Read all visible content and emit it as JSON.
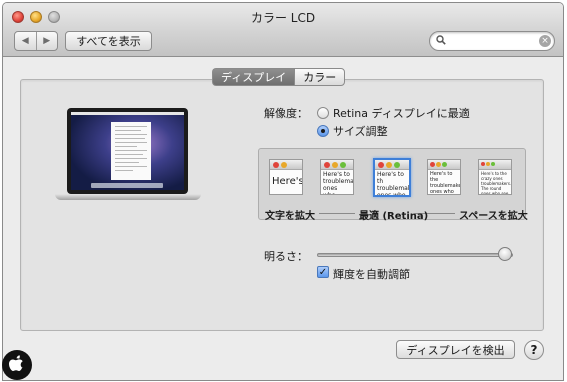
{
  "window": {
    "title": "カラー LCD"
  },
  "toolbar": {
    "back_icon": "back-arrow-icon",
    "forward_icon": "forward-arrow-icon",
    "show_all_label": "すべてを表示",
    "search_value": ""
  },
  "tabs": [
    {
      "label": "ディスプレイ",
      "selected": true
    },
    {
      "label": "カラー",
      "selected": false
    }
  ],
  "resolution": {
    "label": "解像度：",
    "options": [
      {
        "label": "Retina ディスプレイに最適",
        "selected": false
      },
      {
        "label": "サイズ調整",
        "selected": true
      }
    ]
  },
  "scaling": {
    "thumbnails": [
      {
        "text": "Here's",
        "selected": false
      },
      {
        "text": "Here's to troublemakers. ones who",
        "selected": false
      },
      {
        "text": "Here's to th troublemak ones who",
        "selected": true
      },
      {
        "text": "Here's to the troublemakers. ones who see t rules. And the",
        "selected": false
      },
      {
        "text": "Here's to the crazy ones troublemakers. The round ones who see things diff rules. And they have no",
        "selected": false
      }
    ],
    "labels": {
      "left": "文字を拡大",
      "center": "最適 (Retina)",
      "right": "スペースを拡大"
    }
  },
  "brightness": {
    "label": "明るさ：",
    "level": 0.98,
    "auto_label": "輝度を自動調節",
    "auto_checked": true
  },
  "footer": {
    "detect_label": "ディスプレイを検出",
    "help_label": "?"
  },
  "colors": {
    "accent": "#3e7fd8",
    "close": "#e0443a",
    "minimize": "#e8a82a"
  }
}
